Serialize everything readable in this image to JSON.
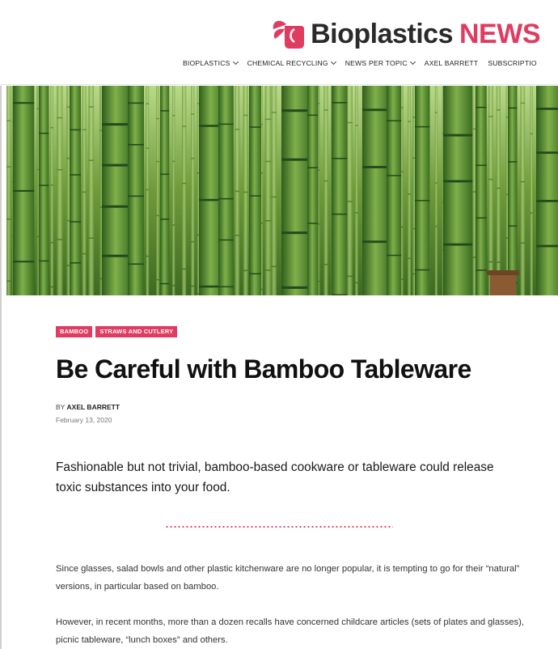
{
  "site": {
    "logo_main": "Bioplastics",
    "logo_accent": "NEWS"
  },
  "nav": [
    {
      "label": "BIOPLASTICS",
      "has_dropdown": true
    },
    {
      "label": "CHEMICAL RECYCLING",
      "has_dropdown": true
    },
    {
      "label": "NEWS PER TOPIC",
      "has_dropdown": true
    },
    {
      "label": "AXEL BARRETT",
      "has_dropdown": false
    },
    {
      "label": "SUBSCRIPTIO",
      "has_dropdown": false
    }
  ],
  "hero": {
    "icon": "bamboo-forest-image"
  },
  "article": {
    "tags": [
      "BAMBOO",
      "STRAWS AND CUTLERY"
    ],
    "title": "Be Careful with Bamboo Tableware",
    "by_prefix": "BY ",
    "author": "AXEL BARRETT",
    "date": "February 13, 2020",
    "lede": "Fashionable but not trivial, bamboo-based cookware or tableware could release toxic substances into your food.",
    "paragraphs": [
      "Since glasses, salad bowls and other plastic kitchenware are no longer popular, it is tempting to go for their “natural” versions, in particular based on bamboo.",
      "However, in recent months, more than a dozen recalls have concerned childcare articles (sets of plates and glasses), picnic tableware, “lunch boxes” and others."
    ]
  },
  "colors": {
    "accent": "#e03c61",
    "text": "#111111",
    "bamboo_green": "#6f9a3b"
  }
}
